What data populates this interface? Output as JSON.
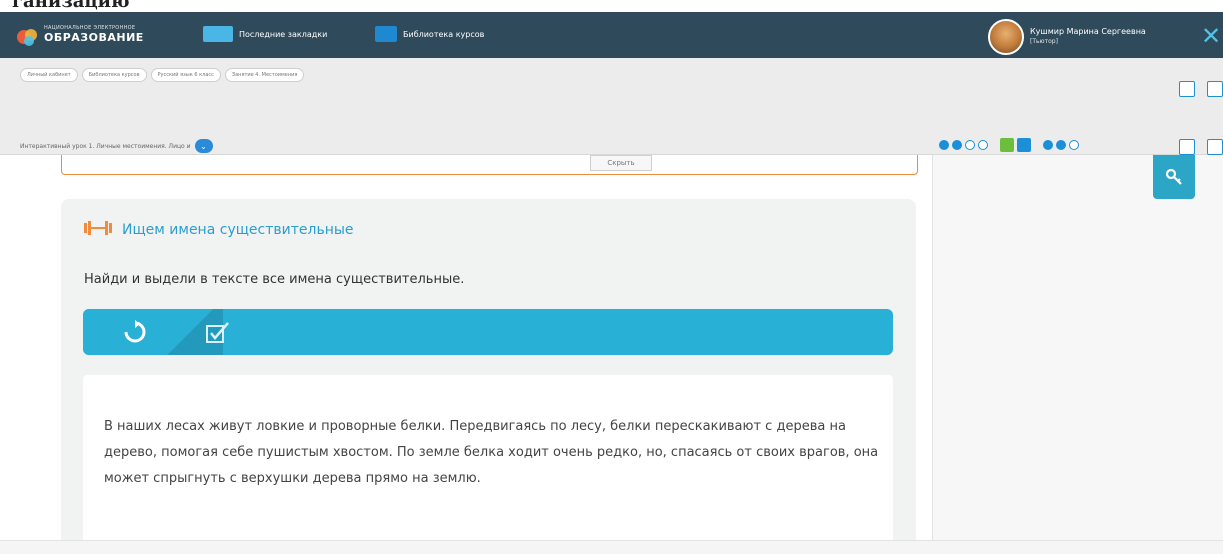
{
  "header": {
    "logo_small": "НАЦИОНАЛЬНОЕ ЭЛЕКТРОННОЕ",
    "logo_title": "ОБРАЗОВАНИЕ",
    "nav": [
      {
        "label": "Последние закладки",
        "icon": "bookmarks-icon"
      },
      {
        "label": "Библиотека курсов",
        "icon": "library-icon"
      }
    ],
    "user": {
      "name": "Кушмир Марина Сергеевна",
      "role": "[Тьютор]"
    },
    "close": "✕"
  },
  "breadcrumbs": [
    "Личный кабинет",
    "Библиотека курсов",
    "Русский язык 6 класс",
    "Занятие 4. Местоимения"
  ],
  "lesson_select": {
    "value": "Интерактивный урок 1. Личные местоимения. Лицо и"
  },
  "hide_button": "Скрыть",
  "exercise": {
    "title": "Ищем имена существительные",
    "instruction": "Найди и выдели в тексте все имена существительные.",
    "passage": "В наших лесах живут ловкие и проворные белки. Передвигаясь по лесу, белки перескакивают с дерева на дерево, помогая себе пушистым хвостом. По земле белка ходит очень редко, но, спасаясь от своих врагов, она может спрыгнуть с верхушки дерева прямо на землю."
  },
  "colors": {
    "header_bg": "#2f4a5a",
    "accent_blue": "#2ba6c7",
    "orange": "#f08a3c",
    "title_blue": "#2a9fce"
  }
}
